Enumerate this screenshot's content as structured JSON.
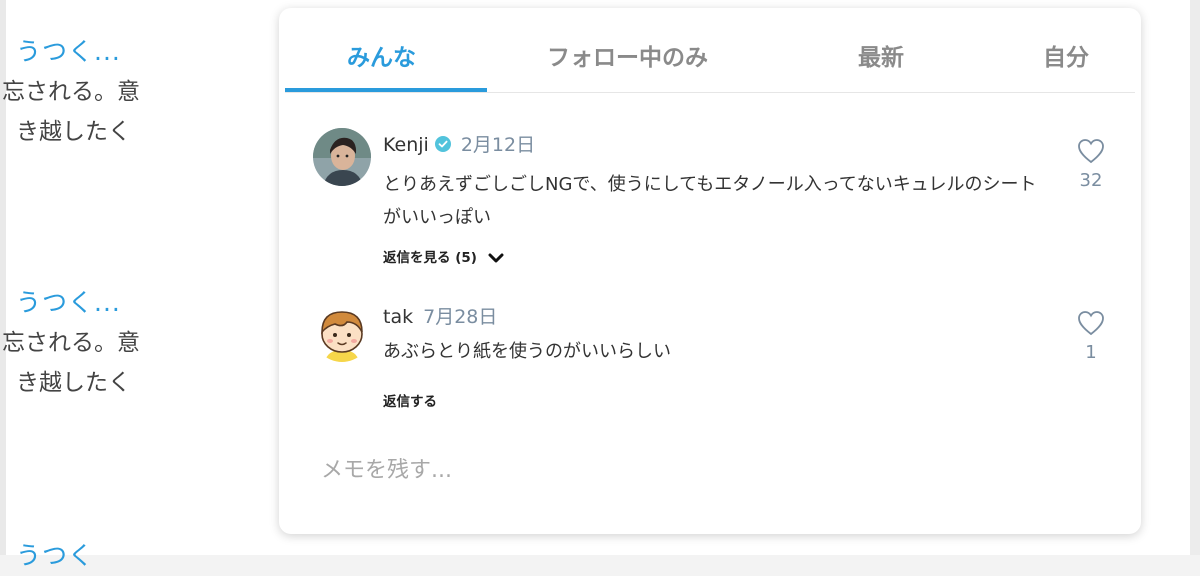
{
  "background": {
    "items": [
      {
        "title": "うつく...",
        "lines": [
          "忘される。意",
          "き越したく"
        ]
      },
      {
        "title": "うつく...",
        "lines": [
          "忘される。意",
          "き越したく"
        ]
      },
      {
        "title": "うつく",
        "lines": []
      }
    ]
  },
  "tabs": [
    {
      "label": "みんな",
      "active": true
    },
    {
      "label": "フォロー中のみ",
      "active": false
    },
    {
      "label": "最新",
      "active": false
    },
    {
      "label": "自分",
      "active": false
    }
  ],
  "comments": [
    {
      "author": "Kenji",
      "verified": true,
      "date": "2月12日",
      "body": "とりあえずごしごしNGで、使うにしてもエタノール入ってないキュレルのシートがいいっぽい",
      "action": "返信を見る (5)",
      "likes": "32",
      "avatar_icon": "person-photo"
    },
    {
      "author": "tak",
      "verified": false,
      "date": "7月28日",
      "body": "あぶらとり紙を使うのがいいらしい",
      "action": "返信する",
      "likes": "1",
      "avatar_icon": "boy-illustration"
    }
  ],
  "memo": {
    "placeholder": "メモを残す..."
  },
  "colors": {
    "accent": "#2a9bdc",
    "verified": "#52c3dc",
    "muted": "#7a8da0"
  }
}
